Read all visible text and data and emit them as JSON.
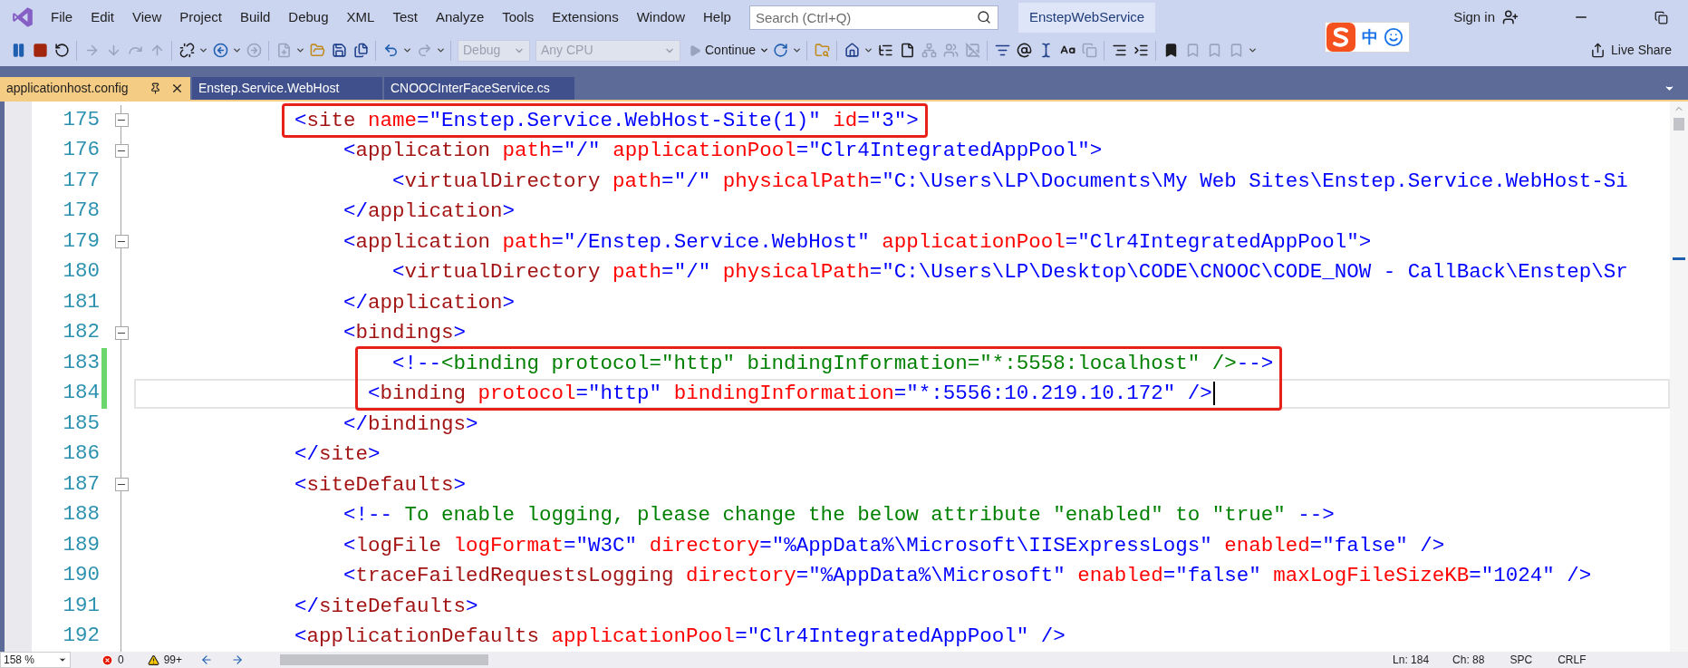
{
  "menu": [
    "File",
    "Edit",
    "View",
    "Project",
    "Build",
    "Debug",
    "XML",
    "Test",
    "Analyze",
    "Tools",
    "Extensions",
    "Window",
    "Help"
  ],
  "search": {
    "placeholder": "Search (Ctrl+Q)"
  },
  "solution_name": "EnstepWebService",
  "sign_in": "Sign in",
  "ime": {
    "mode": "中"
  },
  "toolbar": {
    "configuration": {
      "value": "Debug",
      "disabled": true
    },
    "platform": {
      "value": "Any CPU",
      "disabled": true
    },
    "continue_button": "Continue",
    "live_share": "Live Share"
  },
  "tabs": [
    {
      "label": "applicationhost.config",
      "selected": true
    },
    {
      "label": "Enstep.Service.WebHost",
      "selected": false
    },
    {
      "label": "CNOOCInterFaceService.cs",
      "selected": false
    }
  ],
  "lines": [
    {
      "number": "175",
      "fold": true,
      "changed": false,
      "boxed": true,
      "current": false,
      "tokens": [
        {
          "kind": "punct",
          "text": "            <"
        },
        {
          "kind": "tag",
          "text": "site"
        },
        {
          "kind": "attr",
          "text": " name"
        },
        {
          "kind": "punct",
          "text": "="
        },
        {
          "kind": "value",
          "text": "\"Enstep.Service.WebHost-Site(1)\""
        },
        {
          "kind": "attr",
          "text": " id"
        },
        {
          "kind": "punct",
          "text": "="
        },
        {
          "kind": "value",
          "text": "\"3\""
        },
        {
          "kind": "punct",
          "text": ">"
        }
      ]
    },
    {
      "number": "176",
      "fold": true,
      "changed": false,
      "boxed": false,
      "current": false,
      "tokens": [
        {
          "kind": "punct",
          "text": "                <"
        },
        {
          "kind": "tag",
          "text": "application"
        },
        {
          "kind": "attr",
          "text": " path"
        },
        {
          "kind": "punct",
          "text": "="
        },
        {
          "kind": "value",
          "text": "\"/\""
        },
        {
          "kind": "attr",
          "text": " applicationPool"
        },
        {
          "kind": "punct",
          "text": "="
        },
        {
          "kind": "value",
          "text": "\"Clr4IntegratedAppPool\""
        },
        {
          "kind": "punct",
          "text": ">"
        }
      ]
    },
    {
      "number": "177",
      "fold": false,
      "changed": false,
      "boxed": false,
      "current": false,
      "tokens": [
        {
          "kind": "punct",
          "text": "                    <"
        },
        {
          "kind": "tag",
          "text": "virtualDirectory"
        },
        {
          "kind": "attr",
          "text": " path"
        },
        {
          "kind": "punct",
          "text": "="
        },
        {
          "kind": "value",
          "text": "\"/\""
        },
        {
          "kind": "attr",
          "text": " physicalPath"
        },
        {
          "kind": "punct",
          "text": "="
        },
        {
          "kind": "value",
          "text": "\"C:\\Users\\LP\\Documents\\My Web Sites\\Enstep.Service.WebHost-Si"
        }
      ]
    },
    {
      "number": "178",
      "fold": false,
      "changed": false,
      "boxed": false,
      "current": false,
      "tokens": [
        {
          "kind": "punct",
          "text": "                </"
        },
        {
          "kind": "tag",
          "text": "application"
        },
        {
          "kind": "punct",
          "text": ">"
        }
      ]
    },
    {
      "number": "179",
      "fold": true,
      "changed": false,
      "boxed": false,
      "current": false,
      "tokens": [
        {
          "kind": "punct",
          "text": "                <"
        },
        {
          "kind": "tag",
          "text": "application"
        },
        {
          "kind": "attr",
          "text": " path"
        },
        {
          "kind": "punct",
          "text": "="
        },
        {
          "kind": "value",
          "text": "\"/Enstep.Service.WebHost\""
        },
        {
          "kind": "attr",
          "text": " applicationPool"
        },
        {
          "kind": "punct",
          "text": "="
        },
        {
          "kind": "value",
          "text": "\"Clr4IntegratedAppPool\""
        },
        {
          "kind": "punct",
          "text": ">"
        }
      ]
    },
    {
      "number": "180",
      "fold": false,
      "changed": false,
      "boxed": false,
      "current": false,
      "tokens": [
        {
          "kind": "punct",
          "text": "                    <"
        },
        {
          "kind": "tag",
          "text": "virtualDirectory"
        },
        {
          "kind": "attr",
          "text": " path"
        },
        {
          "kind": "punct",
          "text": "="
        },
        {
          "kind": "value",
          "text": "\"/\""
        },
        {
          "kind": "attr",
          "text": " physicalPath"
        },
        {
          "kind": "punct",
          "text": "="
        },
        {
          "kind": "value",
          "text": "\"C:\\Users\\LP\\Desktop\\CODE\\CNOOC\\CODE_NOW - CallBack\\Enstep\\Sr"
        }
      ]
    },
    {
      "number": "181",
      "fold": false,
      "changed": false,
      "boxed": false,
      "current": false,
      "tokens": [
        {
          "kind": "punct",
          "text": "                </"
        },
        {
          "kind": "tag",
          "text": "application"
        },
        {
          "kind": "punct",
          "text": ">"
        }
      ]
    },
    {
      "number": "182",
      "fold": true,
      "changed": false,
      "boxed": false,
      "current": false,
      "tokens": [
        {
          "kind": "punct",
          "text": "                <"
        },
        {
          "kind": "tag",
          "text": "bindings"
        },
        {
          "kind": "punct",
          "text": ">"
        }
      ]
    },
    {
      "number": "183",
      "fold": false,
      "changed": true,
      "boxed": true,
      "current": false,
      "tokens": [
        {
          "kind": "punct",
          "text": "                    <!--"
        },
        {
          "kind": "comment",
          "text": "<binding protocol=\"http\" bindingInformation=\"*:5558:localhost\" />"
        },
        {
          "kind": "punct",
          "text": "-->"
        }
      ]
    },
    {
      "number": "184",
      "fold": false,
      "changed": true,
      "boxed": true,
      "current": true,
      "tokens": [
        {
          "kind": "punct",
          "text": "                  <"
        },
        {
          "kind": "tag",
          "text": "binding"
        },
        {
          "kind": "attr",
          "text": " protocol"
        },
        {
          "kind": "punct",
          "text": "="
        },
        {
          "kind": "value",
          "text": "\"http\""
        },
        {
          "kind": "attr",
          "text": " bindingInformation"
        },
        {
          "kind": "punct",
          "text": "="
        },
        {
          "kind": "value",
          "text": "\"*:5556:10.219.10.172\""
        },
        {
          "kind": "punct",
          "text": " />"
        }
      ]
    },
    {
      "number": "185",
      "fold": false,
      "changed": false,
      "boxed": false,
      "current": false,
      "tokens": [
        {
          "kind": "punct",
          "text": "                </"
        },
        {
          "kind": "tag",
          "text": "bindings"
        },
        {
          "kind": "punct",
          "text": ">"
        }
      ]
    },
    {
      "number": "186",
      "fold": false,
      "changed": false,
      "boxed": false,
      "current": false,
      "tokens": [
        {
          "kind": "punct",
          "text": "            </"
        },
        {
          "kind": "tag",
          "text": "site"
        },
        {
          "kind": "punct",
          "text": ">"
        }
      ]
    },
    {
      "number": "187",
      "fold": true,
      "changed": false,
      "boxed": false,
      "current": false,
      "tokens": [
        {
          "kind": "punct",
          "text": "            <"
        },
        {
          "kind": "tag",
          "text": "siteDefaults"
        },
        {
          "kind": "punct",
          "text": ">"
        }
      ]
    },
    {
      "number": "188",
      "fold": false,
      "changed": false,
      "boxed": false,
      "current": false,
      "tokens": [
        {
          "kind": "punct",
          "text": "                <!--"
        },
        {
          "kind": "comment",
          "text": " To enable logging, please change the below attribute \"enabled\" to \"true\" "
        },
        {
          "kind": "punct",
          "text": "-->"
        }
      ]
    },
    {
      "number": "189",
      "fold": false,
      "changed": false,
      "boxed": false,
      "current": false,
      "tokens": [
        {
          "kind": "punct",
          "text": "                <"
        },
        {
          "kind": "tag",
          "text": "logFile"
        },
        {
          "kind": "attr",
          "text": " logFormat"
        },
        {
          "kind": "punct",
          "text": "="
        },
        {
          "kind": "value",
          "text": "\"W3C\""
        },
        {
          "kind": "attr",
          "text": " directory"
        },
        {
          "kind": "punct",
          "text": "="
        },
        {
          "kind": "value",
          "text": "\"%AppData%\\Microsoft\\IISExpressLogs\""
        },
        {
          "kind": "attr",
          "text": " enabled"
        },
        {
          "kind": "punct",
          "text": "="
        },
        {
          "kind": "value",
          "text": "\"false\""
        },
        {
          "kind": "punct",
          "text": " />"
        }
      ]
    },
    {
      "number": "190",
      "fold": false,
      "changed": false,
      "boxed": false,
      "current": false,
      "tokens": [
        {
          "kind": "punct",
          "text": "                <"
        },
        {
          "kind": "tag",
          "text": "traceFailedRequestsLogging"
        },
        {
          "kind": "attr",
          "text": " directory"
        },
        {
          "kind": "punct",
          "text": "="
        },
        {
          "kind": "value",
          "text": "\"%AppData%\\Microsoft\""
        },
        {
          "kind": "attr",
          "text": " enabled"
        },
        {
          "kind": "punct",
          "text": "="
        },
        {
          "kind": "value",
          "text": "\"false\""
        },
        {
          "kind": "attr",
          "text": " maxLogFileSizeKB"
        },
        {
          "kind": "punct",
          "text": "="
        },
        {
          "kind": "value",
          "text": "\"1024\""
        },
        {
          "kind": "punct",
          "text": " />"
        }
      ]
    },
    {
      "number": "191",
      "fold": false,
      "changed": false,
      "boxed": false,
      "current": false,
      "tokens": [
        {
          "kind": "punct",
          "text": "            </"
        },
        {
          "kind": "tag",
          "text": "siteDefaults"
        },
        {
          "kind": "punct",
          "text": ">"
        }
      ]
    },
    {
      "number": "192",
      "fold": false,
      "changed": false,
      "boxed": false,
      "current": false,
      "tokens": [
        {
          "kind": "punct",
          "text": "            <"
        },
        {
          "kind": "tag",
          "text": "applicationDefaults"
        },
        {
          "kind": "attr",
          "text": " applicationPool"
        },
        {
          "kind": "punct",
          "text": "="
        },
        {
          "kind": "value",
          "text": "\"Clr4IntegratedAppPool\""
        },
        {
          "kind": "punct",
          "text": " />"
        }
      ]
    }
  ],
  "status_bar": {
    "zoom": "158 %",
    "errors": "0",
    "warnings": "99+",
    "line": "Ln: 184",
    "column": "Ch: 88",
    "whitespace": "SPC",
    "line_ending": "CRLF"
  }
}
